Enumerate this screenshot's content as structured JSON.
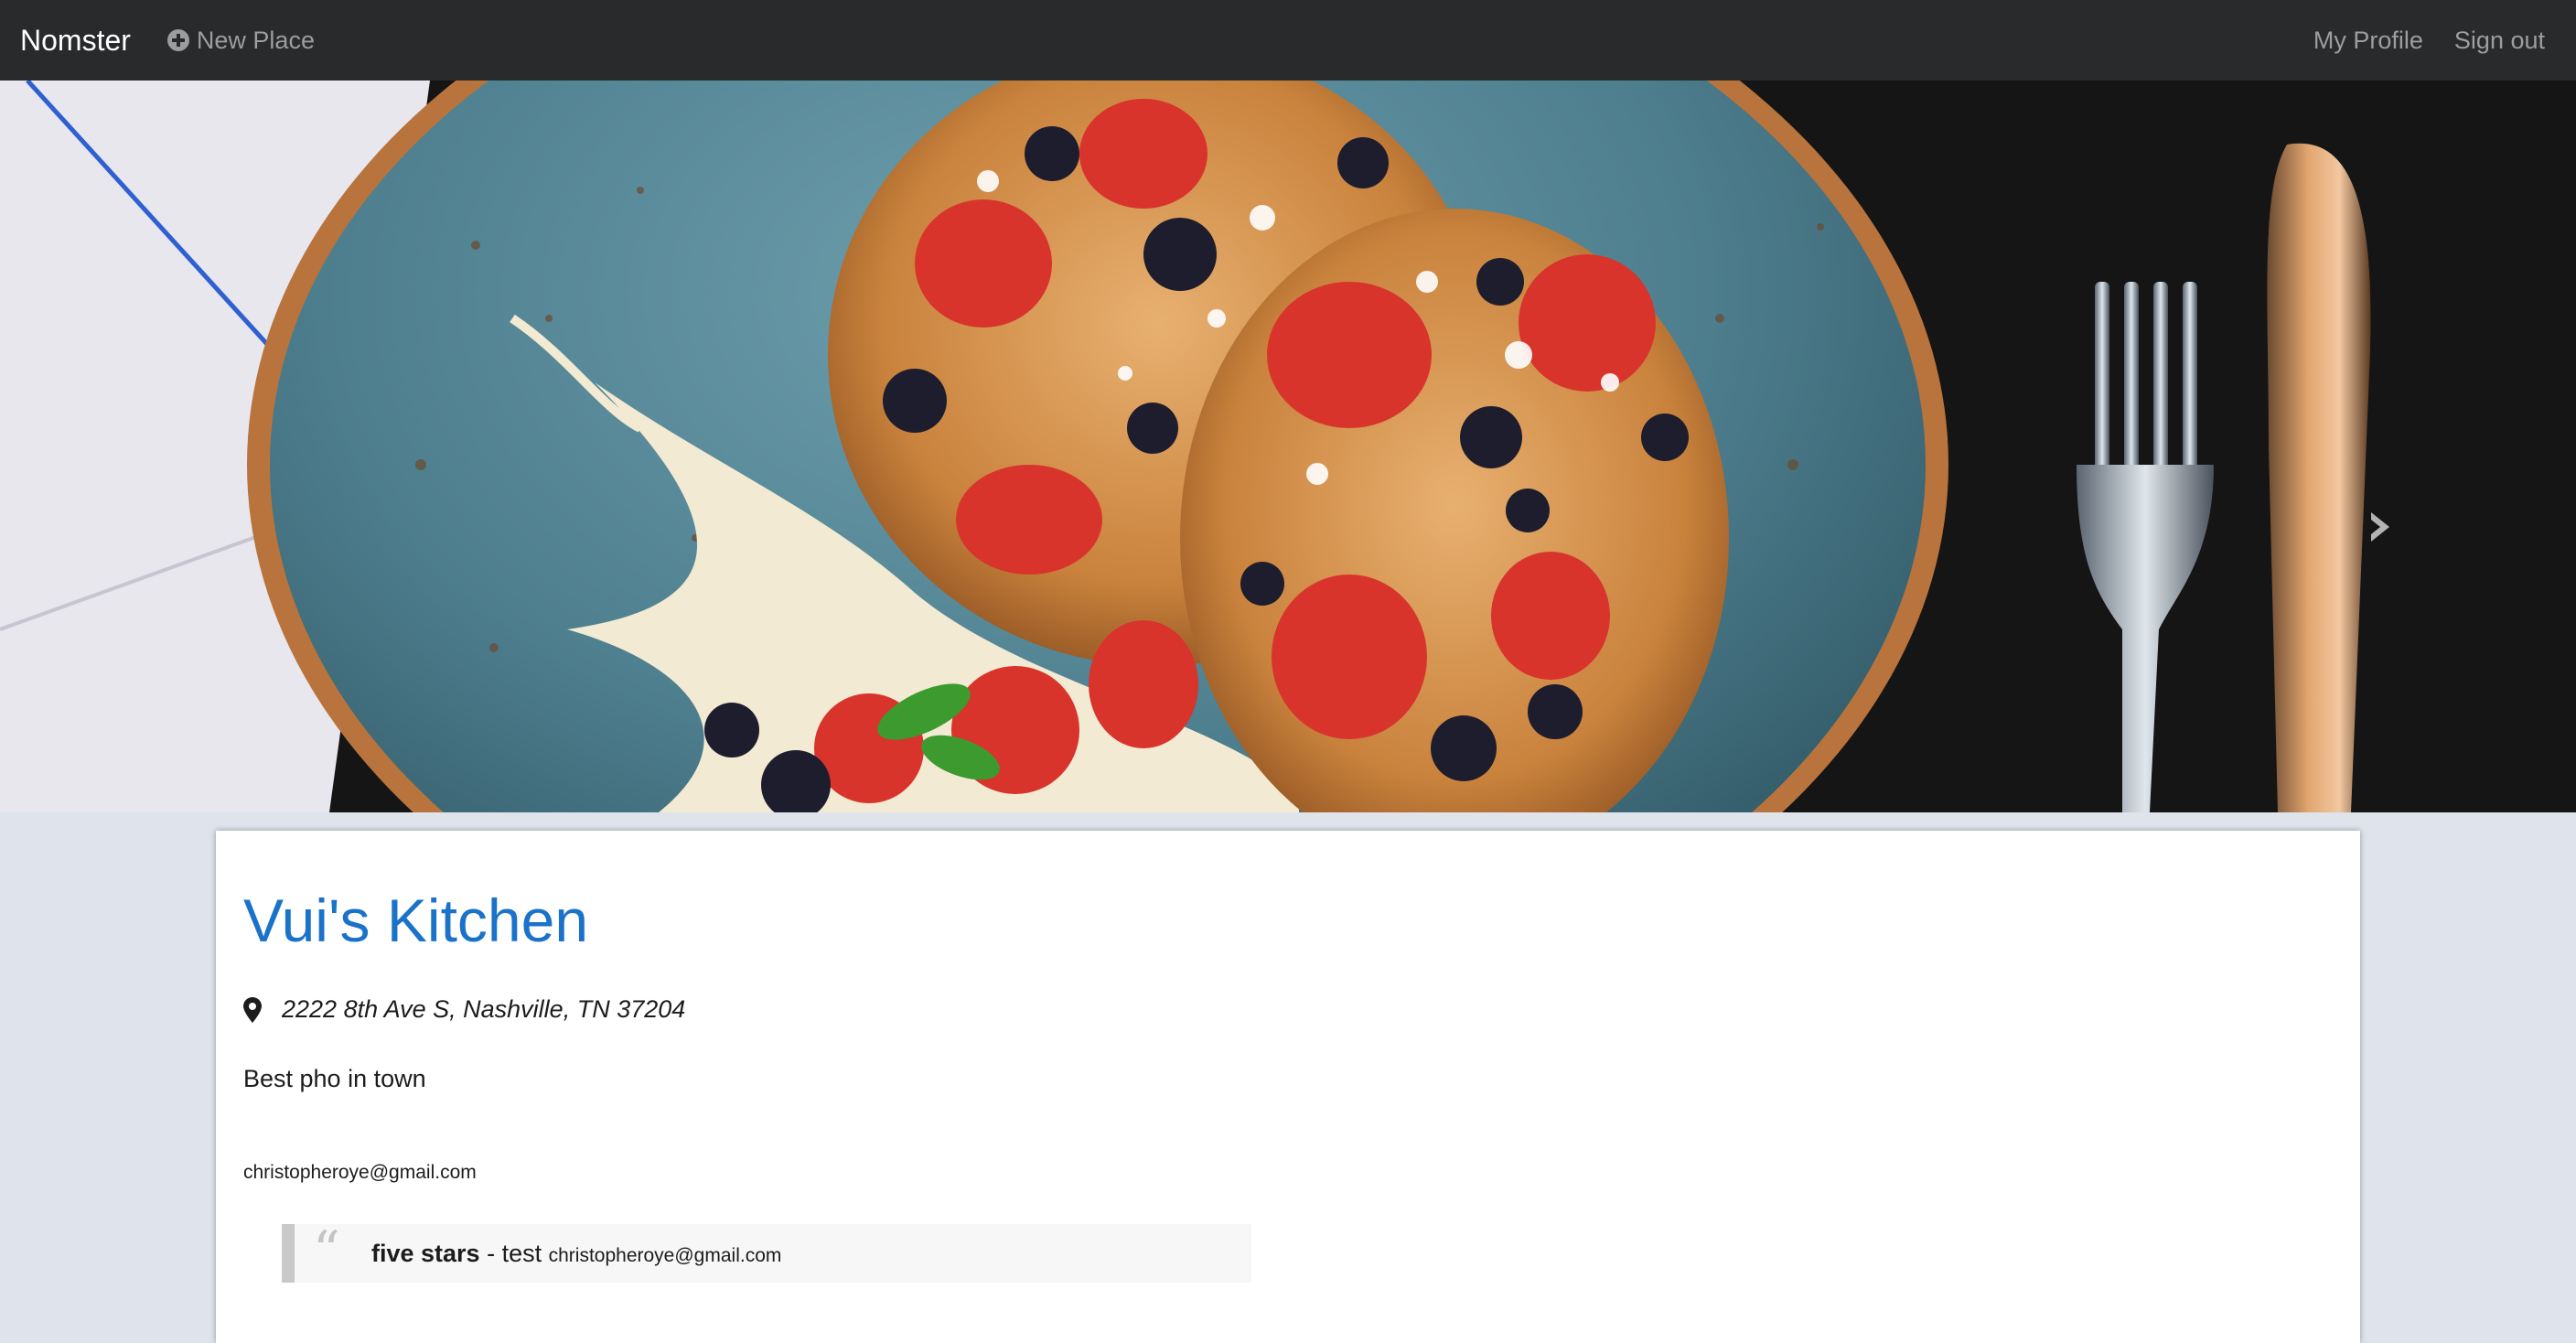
{
  "navbar": {
    "brand": "Nomster",
    "new_place_label": "New Place",
    "new_place_icon": "plus-circle-icon",
    "my_profile_label": "My Profile",
    "sign_out_label": "Sign out",
    "background_color": "#282a2c"
  },
  "hero": {
    "image_description_icon": "hero-photo",
    "next_control_icon": "chevron-right-icon"
  },
  "place": {
    "name": "Vui's Kitchen",
    "address_icon": "map-marker-icon",
    "address": "2222 8th Ave S, Nashville, TN 37204",
    "description": "Best pho in town",
    "owner_email": "christopheroye@gmail.com",
    "title_color": "#1a73c8"
  },
  "comments": [
    {
      "rating": "five stars",
      "separator": " - ",
      "message": "test",
      "user_email": "christopheroye@gmail.com",
      "icon": "quote-icon"
    }
  ],
  "colors": {
    "page_background": "#dfe3ec",
    "card_background": "#ffffff"
  }
}
